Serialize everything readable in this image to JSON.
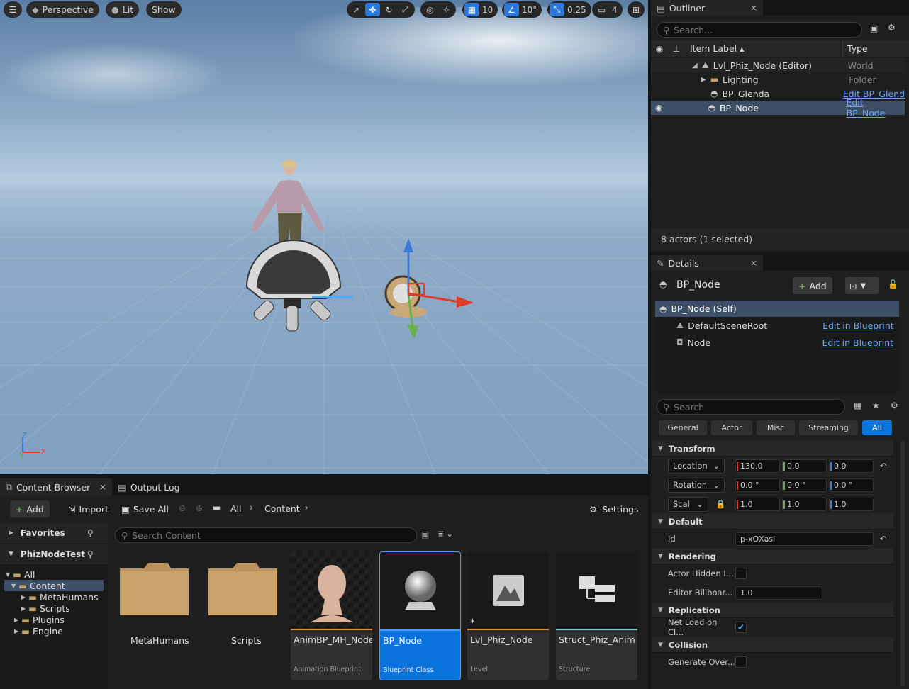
{
  "viewport": {
    "perspective": "Perspective",
    "lit": "Lit",
    "show": "Show",
    "grid_snap": "10",
    "rot_snap": "10°",
    "scale_snap": "0.25",
    "cam_speed": "4",
    "axis_z": "Z",
    "axis_x": "X",
    "axis_y": "Y"
  },
  "outliner": {
    "tab": "Outliner",
    "search_placeholder": "Search...",
    "col_label": "Item Label ▴",
    "col_type": "Type",
    "items": [
      {
        "label": "Lvl_Phiz_Node (Editor)",
        "type": "World"
      },
      {
        "label": "Lighting",
        "type": "Folder"
      },
      {
        "label": "BP_Glenda",
        "type": "Edit BP_Glend"
      },
      {
        "label": "BP_Node",
        "type": "Edit BP_Node"
      }
    ],
    "status": "8 actors (1 selected)"
  },
  "details": {
    "tab": "Details",
    "title": "BP_Node",
    "add": "Add",
    "components": [
      {
        "label": "BP_Node (Self)",
        "link": ""
      },
      {
        "label": "DefaultSceneRoot",
        "link": "Edit in Blueprint"
      },
      {
        "label": "Node",
        "link": "Edit in Blueprint"
      }
    ],
    "search_placeholder": "Search",
    "filters": [
      "General",
      "Actor",
      "Misc",
      "Streaming",
      "All"
    ],
    "sections": {
      "transform": "Transform",
      "default": "Default",
      "rendering": "Rendering",
      "replication": "Replication",
      "collision": "Collision"
    },
    "location": {
      "label": "Location",
      "x": "130.0",
      "y": "0.0",
      "z": "0.0"
    },
    "rotation": {
      "label": "Rotation",
      "x": "0.0 °",
      "y": "0.0 °",
      "z": "0.0 °"
    },
    "scale": {
      "label": "Scal",
      "x": "1.0",
      "y": "1.0",
      "z": "1.0"
    },
    "id": {
      "label": "Id",
      "value": "p-xQXasi"
    },
    "actor_hidden": {
      "label": "Actor Hidden I..."
    },
    "billboard": {
      "label": "Editor Billboar...",
      "value": "1.0"
    },
    "net_load": {
      "label": "Net Load on Cl..."
    },
    "generate_overlap": {
      "label": "Generate Over..."
    }
  },
  "content_browser": {
    "tab": "Content Browser",
    "output_log": "Output Log",
    "add": "Add",
    "import": "Import",
    "save_all": "Save All",
    "crumb_all": "All",
    "crumb_content": "Content",
    "settings": "Settings",
    "favorites": "Favorites",
    "project": "PhizNodeTest",
    "search_placeholder": "Search Content",
    "tree": [
      "All",
      "Content",
      "MetaHumans",
      "Scripts",
      "Plugins",
      "Engine"
    ],
    "assets": [
      {
        "name": "MetaHumans",
        "type": ""
      },
      {
        "name": "Scripts",
        "type": ""
      },
      {
        "name": "AnimBP_MH_Node",
        "type": "Animation Blueprint"
      },
      {
        "name": "BP_Node",
        "type": "Blueprint Class"
      },
      {
        "name": "Lvl_Phiz_Node",
        "type": "Level"
      },
      {
        "name": "Struct_Phiz_Anim",
        "type": "Structure"
      }
    ]
  },
  "colors": {
    "accent": "#0a74dc",
    "link": "#6ea6ff",
    "x_axis": "#e03c2c",
    "y_axis": "#6ab04c",
    "z_axis": "#3a7bd5",
    "anim_bp": "#e08a2c",
    "level": "#e08a2c",
    "structure": "#7fc8d0"
  }
}
